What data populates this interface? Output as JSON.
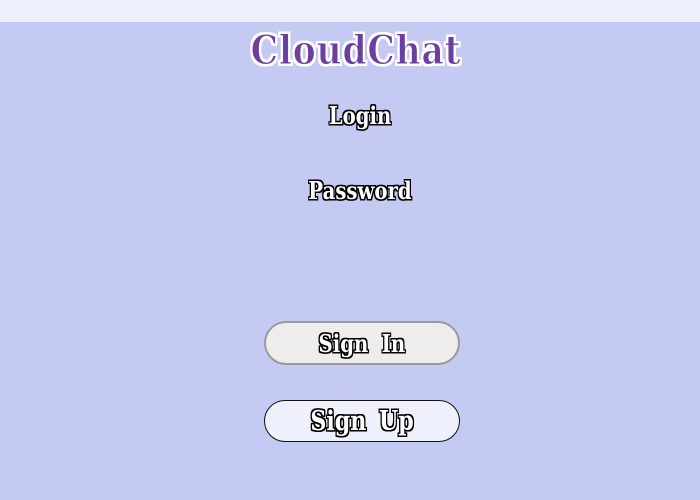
{
  "app": {
    "title": "CloudChat"
  },
  "form": {
    "login_label": "Login",
    "password_label": "Password"
  },
  "buttons": {
    "sign_in": "Sign In",
    "sign_up": "Sign Up"
  },
  "colors": {
    "background": "#c5caf2",
    "top_bar": "#eef1fb",
    "title": "#6a3fa0",
    "sign_in_button": "#efedeb",
    "sign_up_button": "#eef1fc"
  }
}
